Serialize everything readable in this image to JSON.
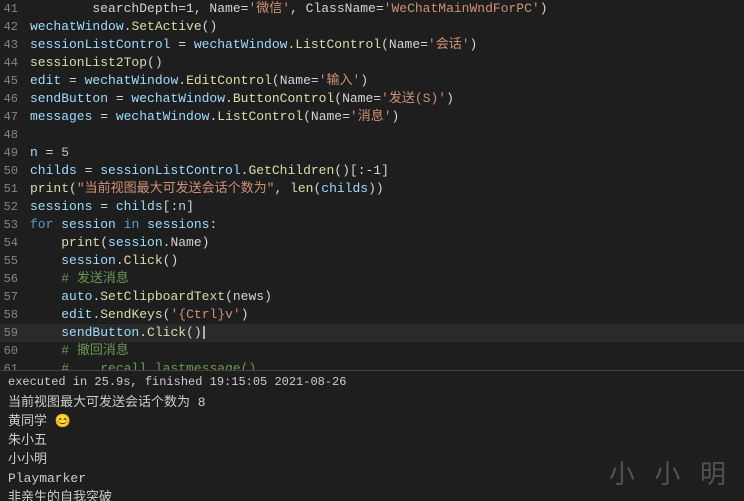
{
  "editor": {
    "lines": [
      {
        "num": "41",
        "tokens": [
          {
            "type": "plain",
            "text": "        searchDepth=1, Name="
          },
          {
            "type": "str",
            "text": "'微信'"
          },
          {
            "type": "plain",
            "text": ", ClassName="
          },
          {
            "type": "str",
            "text": "'WeChatMainWndForPC'"
          },
          {
            "type": "plain",
            "text": ")"
          }
        ]
      },
      {
        "num": "42",
        "tokens": [
          {
            "type": "var",
            "text": "wechatWindow"
          },
          {
            "type": "plain",
            "text": "."
          },
          {
            "type": "fn",
            "text": "SetActive"
          },
          {
            "type": "plain",
            "text": "()"
          }
        ]
      },
      {
        "num": "43",
        "tokens": [
          {
            "type": "var",
            "text": "sessionListControl"
          },
          {
            "type": "plain",
            "text": " = "
          },
          {
            "type": "var",
            "text": "wechatWindow"
          },
          {
            "type": "plain",
            "text": "."
          },
          {
            "type": "fn",
            "text": "ListControl"
          },
          {
            "type": "plain",
            "text": "(Name="
          },
          {
            "type": "str",
            "text": "'会话'"
          },
          {
            "type": "plain",
            "text": ")"
          }
        ]
      },
      {
        "num": "44",
        "tokens": [
          {
            "type": "fn",
            "text": "sessionList2Top"
          },
          {
            "type": "plain",
            "text": "()"
          }
        ]
      },
      {
        "num": "45",
        "tokens": [
          {
            "type": "var",
            "text": "edit"
          },
          {
            "type": "plain",
            "text": " = "
          },
          {
            "type": "var",
            "text": "wechatWindow"
          },
          {
            "type": "plain",
            "text": "."
          },
          {
            "type": "fn",
            "text": "EditControl"
          },
          {
            "type": "plain",
            "text": "(Name="
          },
          {
            "type": "str",
            "text": "'输入'"
          },
          {
            "type": "plain",
            "text": ")"
          }
        ]
      },
      {
        "num": "46",
        "tokens": [
          {
            "type": "var",
            "text": "sendButton"
          },
          {
            "type": "plain",
            "text": " = "
          },
          {
            "type": "var",
            "text": "wechatWindow"
          },
          {
            "type": "plain",
            "text": "."
          },
          {
            "type": "fn",
            "text": "ButtonControl"
          },
          {
            "type": "plain",
            "text": "(Name="
          },
          {
            "type": "str",
            "text": "'发送(S)'"
          },
          {
            "type": "plain",
            "text": ")"
          }
        ]
      },
      {
        "num": "47",
        "tokens": [
          {
            "type": "var",
            "text": "messages"
          },
          {
            "type": "plain",
            "text": " = "
          },
          {
            "type": "var",
            "text": "wechatWindow"
          },
          {
            "type": "plain",
            "text": "."
          },
          {
            "type": "fn",
            "text": "ListControl"
          },
          {
            "type": "plain",
            "text": "(Name="
          },
          {
            "type": "str",
            "text": "'消息'"
          },
          {
            "type": "plain",
            "text": ")"
          }
        ]
      },
      {
        "num": "48",
        "tokens": []
      },
      {
        "num": "49",
        "tokens": [
          {
            "type": "var",
            "text": "n"
          },
          {
            "type": "plain",
            "text": " = "
          },
          {
            "type": "num",
            "text": "5"
          }
        ]
      },
      {
        "num": "50",
        "tokens": [
          {
            "type": "var",
            "text": "childs"
          },
          {
            "type": "plain",
            "text": " = "
          },
          {
            "type": "var",
            "text": "sessionListControl"
          },
          {
            "type": "plain",
            "text": "."
          },
          {
            "type": "fn",
            "text": "GetChildren"
          },
          {
            "type": "plain",
            "text": "()[:-1]"
          }
        ]
      },
      {
        "num": "51",
        "tokens": [
          {
            "type": "fn",
            "text": "print"
          },
          {
            "type": "plain",
            "text": "("
          },
          {
            "type": "str",
            "text": "\"当前视图最大可发送会话个数为\""
          },
          {
            "type": "plain",
            "text": ", "
          },
          {
            "type": "fn",
            "text": "len"
          },
          {
            "type": "plain",
            "text": "("
          },
          {
            "type": "var",
            "text": "childs"
          },
          {
            "type": "plain",
            "text": "))"
          }
        ]
      },
      {
        "num": "52",
        "tokens": [
          {
            "type": "var",
            "text": "sessions"
          },
          {
            "type": "plain",
            "text": " = "
          },
          {
            "type": "var",
            "text": "childs"
          },
          {
            "type": "plain",
            "text": "[:"
          },
          {
            "type": "var",
            "text": "n"
          },
          {
            "type": "plain",
            "text": "]"
          }
        ]
      },
      {
        "num": "53",
        "tokens": [
          {
            "type": "kw",
            "text": "for"
          },
          {
            "type": "plain",
            "text": " "
          },
          {
            "type": "var",
            "text": "session"
          },
          {
            "type": "plain",
            "text": " "
          },
          {
            "type": "kw",
            "text": "in"
          },
          {
            "type": "plain",
            "text": " "
          },
          {
            "type": "var",
            "text": "sessions"
          },
          {
            "type": "plain",
            "text": ":"
          }
        ]
      },
      {
        "num": "54",
        "tokens": [
          {
            "type": "plain",
            "text": "    "
          },
          {
            "type": "fn",
            "text": "print"
          },
          {
            "type": "plain",
            "text": "("
          },
          {
            "type": "var",
            "text": "session"
          },
          {
            "type": "plain",
            "text": ".Name)"
          }
        ]
      },
      {
        "num": "55",
        "tokens": [
          {
            "type": "plain",
            "text": "    "
          },
          {
            "type": "var",
            "text": "session"
          },
          {
            "type": "plain",
            "text": "."
          },
          {
            "type": "fn",
            "text": "Click"
          },
          {
            "type": "plain",
            "text": "()"
          }
        ]
      },
      {
        "num": "56",
        "tokens": [
          {
            "type": "plain",
            "text": "    "
          },
          {
            "type": "cm",
            "text": "# 发送消息"
          }
        ]
      },
      {
        "num": "57",
        "tokens": [
          {
            "type": "plain",
            "text": "    "
          },
          {
            "type": "var",
            "text": "auto"
          },
          {
            "type": "plain",
            "text": "."
          },
          {
            "type": "fn",
            "text": "SetClipboardText"
          },
          {
            "type": "plain",
            "text": "(news)"
          }
        ]
      },
      {
        "num": "58",
        "tokens": [
          {
            "type": "plain",
            "text": "    "
          },
          {
            "type": "var",
            "text": "edit"
          },
          {
            "type": "plain",
            "text": "."
          },
          {
            "type": "fn",
            "text": "SendKeys"
          },
          {
            "type": "plain",
            "text": "("
          },
          {
            "type": "str",
            "text": "'{Ctrl}v'"
          },
          {
            "type": "plain",
            "text": ")"
          }
        ]
      },
      {
        "num": "59",
        "tokens": [
          {
            "type": "plain",
            "text": "    "
          },
          {
            "type": "var",
            "text": "sendButton"
          },
          {
            "type": "plain",
            "text": "."
          },
          {
            "type": "fn",
            "text": "Click"
          },
          {
            "type": "plain",
            "text": "()"
          }
        ],
        "highlight": true
      },
      {
        "num": "60",
        "tokens": [
          {
            "type": "plain",
            "text": "    "
          },
          {
            "type": "cm",
            "text": "# 撤回消息"
          }
        ]
      },
      {
        "num": "61",
        "tokens": [
          {
            "type": "plain",
            "text": "    "
          },
          {
            "type": "cm",
            "text": "#    recall_lastmessage()"
          }
        ]
      }
    ]
  },
  "output": {
    "status_bar": "executed in 25.9s, finished 19:15:05 2021-08-26",
    "lines": [
      "当前视图最大可发送会话个数为 8",
      "黄同学 😊",
      "朱小五",
      "小小明",
      "Playmarker",
      "非亲生的自我突破"
    ]
  },
  "watermark": "小 小 明"
}
